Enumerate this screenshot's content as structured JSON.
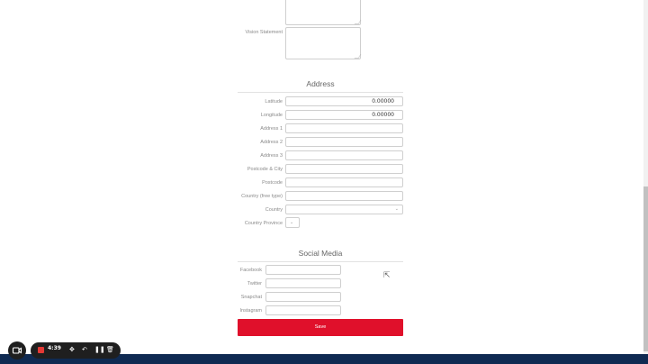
{
  "vision": {
    "label": "Vision Statement"
  },
  "address": {
    "title": "Address",
    "latitude": {
      "label": "Latitude",
      "value": "0.00000"
    },
    "longitude": {
      "label": "Longitude",
      "value": "0.00000"
    },
    "address1": {
      "label": "Address 1"
    },
    "address2": {
      "label": "Address 2"
    },
    "address3": {
      "label": "Address 3"
    },
    "postcode_city": {
      "label": "Postcode & City"
    },
    "postcode": {
      "label": "Postcode"
    },
    "country_free": {
      "label": "Country (free type)"
    },
    "country": {
      "label": "Country"
    },
    "province": {
      "label": "Country Province"
    }
  },
  "social": {
    "title": "Social Media",
    "facebook": {
      "label": "Facebook"
    },
    "twitter": {
      "label": "Twitter"
    },
    "snapchat": {
      "label": "Snapchat"
    },
    "instagram": {
      "label": "Instagram"
    }
  },
  "save_label": "Save",
  "recorder": {
    "time": "4:39"
  },
  "icons": {
    "camera": "camera-icon",
    "stop": "stop-icon",
    "move": "move-icon",
    "undo": "undo-icon",
    "pause": "pause-icon",
    "trash": "trash-icon"
  },
  "colors": {
    "accent": "#e0102b",
    "footer": "#0f2a52"
  }
}
